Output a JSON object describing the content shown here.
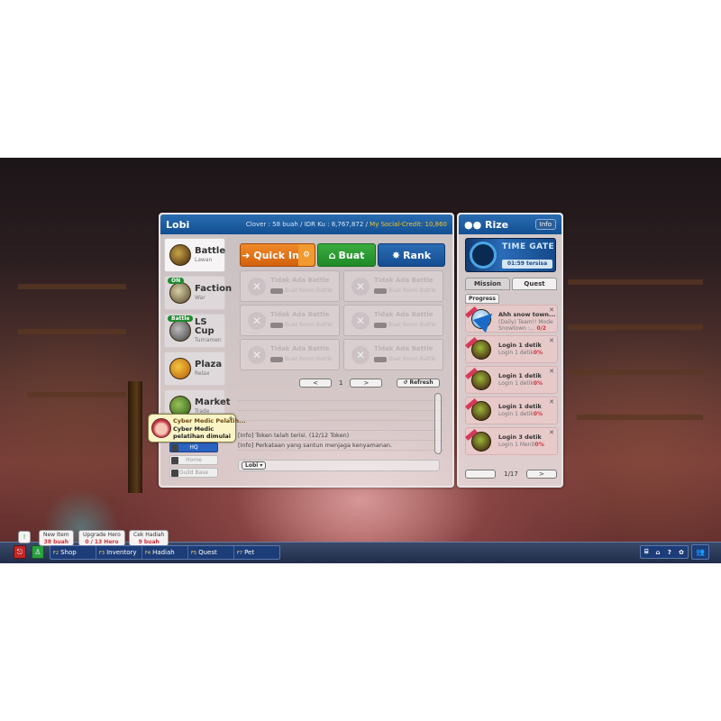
{
  "lobby": {
    "title": "Lobi",
    "stats": {
      "clover": "Clover : 58 buah",
      "idr": "IDR Ku : 8,767,872",
      "separator": "/",
      "social_credit": "My Social-Credit: 10,860"
    },
    "nav": [
      {
        "label": "Battle",
        "sub": "Lawan",
        "badge": "",
        "icon": "battle-icon",
        "active": true
      },
      {
        "label": "Faction",
        "sub": "War",
        "badge": "ON",
        "icon": "faction-icon",
        "active": false
      },
      {
        "label": "LS Cup",
        "sub": "Turnamen",
        "badge": "Battle",
        "icon": "trophy-icon",
        "active": false
      },
      {
        "label": "Plaza",
        "sub": "Relax",
        "badge": "",
        "icon": "plaza-icon",
        "active": false
      },
      {
        "label": "Market",
        "sub": "Trade",
        "badge": "",
        "icon": "market-icon",
        "active": false
      }
    ],
    "subnav": [
      {
        "label": "HQ",
        "active": true
      },
      {
        "label": "Home",
        "active": false
      },
      {
        "label": "Guild Base",
        "active": false
      }
    ],
    "toolbar": {
      "quick_in": "Quick In",
      "quick_in_icon": "➜",
      "settings_icon": "⚙",
      "buat": "Buat",
      "buat_icon": "⌂",
      "rank": "Rank",
      "rank_icon": "✸"
    },
    "rooms": [
      {
        "title": "Tidak Ada Battle",
        "sub": "Buat Room Battle"
      },
      {
        "title": "Tidak Ada Battle",
        "sub": "Buat Room Battle"
      },
      {
        "title": "Tidak Ada Battle",
        "sub": "Buat Room Battle"
      },
      {
        "title": "Tidak Ada Battle",
        "sub": "Buat Room Battle"
      },
      {
        "title": "Tidak Ada Battle",
        "sub": "Buat Room Battle"
      },
      {
        "title": "Tidak Ada Battle",
        "sub": "Buat Room Battle"
      }
    ],
    "pager": {
      "prev": "<",
      "page": "1",
      "next": ">",
      "refresh": "↺ Refresh"
    },
    "chat": {
      "lines": [
        "",
        "",
        "",
        "",
        "[Info] Token telah terisi. (12/12 Token)",
        "[Info] Perkataan yang santun menjaga kenyamanan."
      ],
      "channel": "Lobi ▾",
      "input_value": ""
    },
    "tooltip": {
      "title": "Cyber Medic Pelatih...",
      "body": "Cyber Medic pelatihan dimulai",
      "plus": "+"
    }
  },
  "rize": {
    "title": "Rize",
    "info_label": "Info",
    "timegate": {
      "title": "TIME GATE",
      "time": "01:59 tersisa"
    },
    "tabs": [
      {
        "label": "Mission",
        "active": false
      },
      {
        "label": "Quest",
        "active": true
      }
    ],
    "subtab": "Progress",
    "quests": [
      {
        "title": "Ahh snow town...",
        "desc": "(Daily) Team!! Mode Snowtown :...",
        "progress": "0/2",
        "icon": "snowball-icon"
      },
      {
        "title": "Login 1 detik",
        "desc": "Login 1 detik",
        "progress": "0%",
        "icon": "character-icon"
      },
      {
        "title": "Login 1 detik",
        "desc": "Login 1 detik",
        "progress": "0%",
        "icon": "character-icon"
      },
      {
        "title": "Login 1 detik",
        "desc": "Login 1 detik",
        "progress": "0%",
        "icon": "character-icon"
      },
      {
        "title": "Login 3 detik",
        "desc": "Login 1 Menit",
        "progress": "0%",
        "icon": "character-icon"
      }
    ],
    "pager": {
      "prev": "",
      "page": "1/17",
      "next": ">"
    }
  },
  "bottom": {
    "menu": [
      {
        "key": "F2",
        "label": "Shop"
      },
      {
        "key": "F3",
        "label": "Inventory"
      },
      {
        "key": "F4",
        "label": "Hadiah"
      },
      {
        "key": "F5",
        "label": "Quest"
      },
      {
        "key": "F7",
        "label": "Pet"
      }
    ],
    "tips": [
      {
        "line1": "New Item",
        "line2": "38 buah"
      },
      {
        "line1": "Upgrade Hero",
        "line2": "0 / 13 Hero"
      },
      {
        "line1": "Cek Hadiah",
        "line2": "9 buah"
      }
    ],
    "small_tip": "!",
    "right_icons": [
      "⌸",
      "⌂",
      "?",
      "✿"
    ],
    "friends_icon": "👥"
  }
}
